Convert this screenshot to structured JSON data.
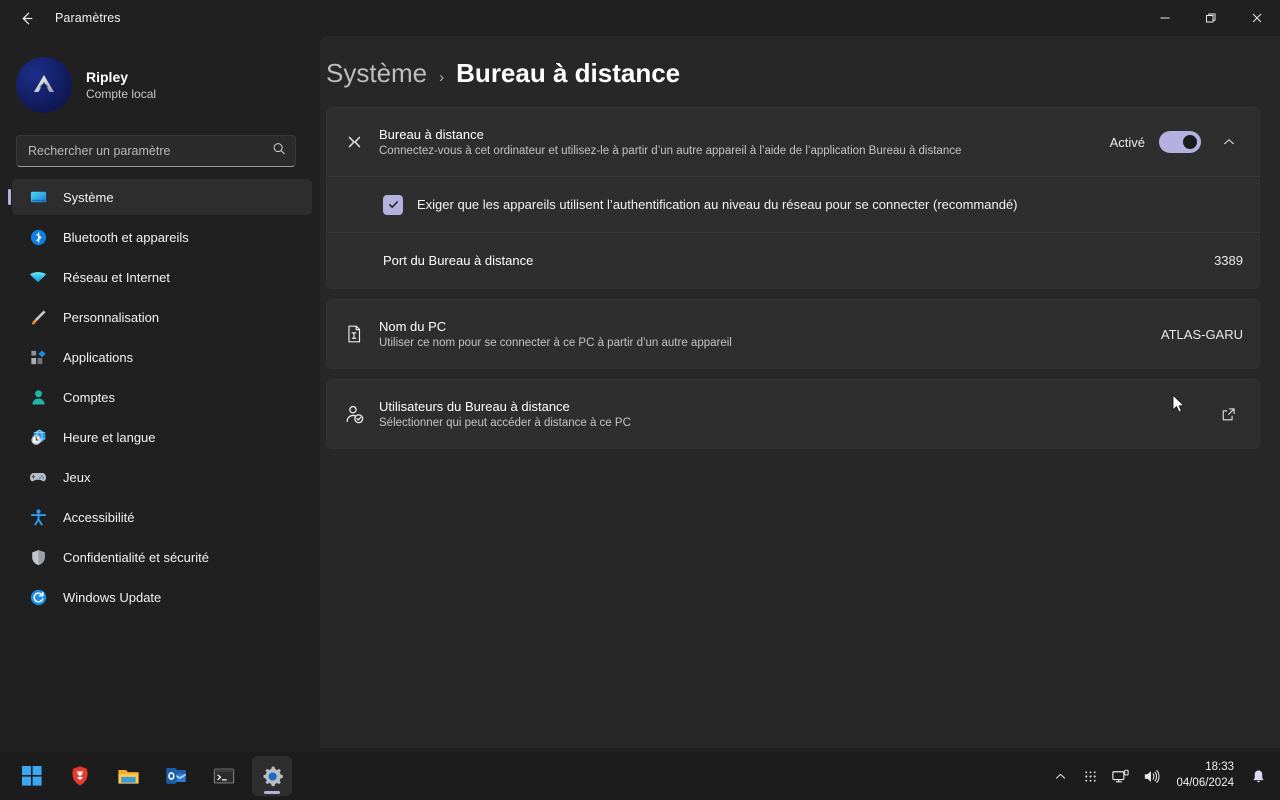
{
  "window": {
    "title": "Paramètres",
    "back_icon": "arrow-left-icon",
    "minimize_label": "—",
    "maximize_label": "❐",
    "close_label": "✕"
  },
  "account": {
    "name": "Ripley",
    "type": "Compte local",
    "avatar_icon": "user-avatar"
  },
  "search": {
    "placeholder": "Rechercher un paramètre",
    "value": "",
    "icon": "search-icon"
  },
  "sidebar": {
    "items": [
      {
        "label": "Système",
        "icon": "monitor-icon",
        "active": true
      },
      {
        "label": "Bluetooth et appareils",
        "icon": "bluetooth-icon",
        "active": false
      },
      {
        "label": "Réseau et Internet",
        "icon": "wifi-icon",
        "active": false
      },
      {
        "label": "Personnalisation",
        "icon": "paintbrush-icon",
        "active": false
      },
      {
        "label": "Applications",
        "icon": "apps-icon",
        "active": false
      },
      {
        "label": "Comptes",
        "icon": "person-icon",
        "active": false
      },
      {
        "label": "Heure et langue",
        "icon": "clock-globe-icon",
        "active": false
      },
      {
        "label": "Jeux",
        "icon": "gamepad-icon",
        "active": false
      },
      {
        "label": "Accessibilité",
        "icon": "accessibility-icon",
        "active": false
      },
      {
        "label": "Confidentialité et sécurité",
        "icon": "shield-icon",
        "active": false
      },
      {
        "label": "Windows Update",
        "icon": "update-icon",
        "active": false
      }
    ]
  },
  "breadcrumb": {
    "parent": "Système",
    "separator": "›",
    "current": "Bureau à distance"
  },
  "settings": {
    "remote_desktop": {
      "icon": "remote-desktop-icon",
      "title": "Bureau à distance",
      "subtitle": "Connectez-vous à cet ordinateur et utilisez-le à partir d’un autre appareil à l’aide de l’application Bureau à distance",
      "toggle_state_label": "Activé",
      "toggle_on": true,
      "expand_icon": "chevron-up-icon"
    },
    "nla_checkbox": {
      "label": "Exiger que les appareils utilisent l’authentification au niveau du réseau pour se connecter (recommandé)",
      "checked": true,
      "check_icon": "check-icon"
    },
    "port": {
      "label": "Port du Bureau à distance",
      "value": "3389"
    },
    "pc_name": {
      "icon": "document-info-icon",
      "title": "Nom du PC",
      "subtitle": "Utiliser ce nom pour se connecter à ce PC à partir d’un autre appareil",
      "value": "ATLAS-GARU"
    },
    "users": {
      "icon": "user-check-icon",
      "title": "Utilisateurs du Bureau à distance",
      "subtitle": "Sélectionner qui peut accéder à distance à ce PC",
      "action_icon": "external-link-icon"
    }
  },
  "taskbar": {
    "apps": [
      {
        "name": "start-button",
        "icon": "windows-logo-icon",
        "active": false
      },
      {
        "name": "brave-browser",
        "icon": "brave-icon",
        "active": false
      },
      {
        "name": "file-explorer",
        "icon": "folder-icon",
        "active": false
      },
      {
        "name": "outlook",
        "icon": "outlook-icon",
        "active": false
      },
      {
        "name": "terminal",
        "icon": "terminal-icon",
        "active": false
      },
      {
        "name": "settings",
        "icon": "gear-icon",
        "active": true
      }
    ],
    "tray": {
      "overflow_icon": "chevron-up-icon",
      "ime_icon": "grid-dots-icon",
      "network_icon": "network-monitor-icon",
      "volume_icon": "speaker-icon",
      "notification_icon": "bell-icon",
      "time": "18:33",
      "date": "04/06/2024"
    }
  },
  "colors": {
    "accent": "#b4b0e0",
    "background": "#202020",
    "content_background": "#272727",
    "card": "#2e2e2e",
    "taskbar": "#1c1c1c"
  }
}
